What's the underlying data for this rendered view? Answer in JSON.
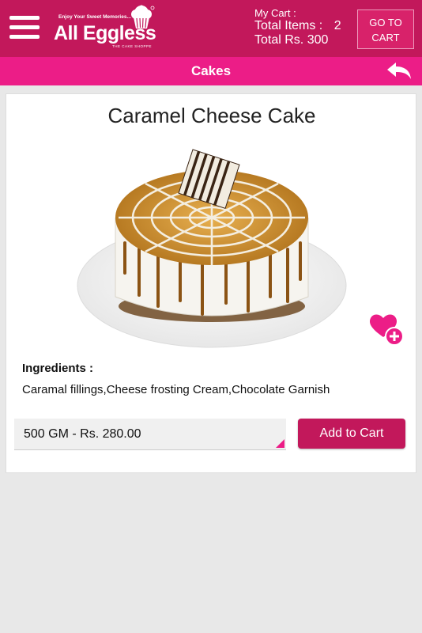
{
  "header": {
    "logo": {
      "tagline": "Enjoy Your Sweet Memories...",
      "name": "All Eggless",
      "subtitle": "THE CAKE SHOPPE"
    },
    "cart": {
      "label": "My Cart  :",
      "total_items_label": "Total Items :",
      "total_items_value": "2",
      "total_amount": "Total Rs. 300"
    },
    "goto_cart": {
      "line1": "GO TO",
      "line2": "CART"
    }
  },
  "titlebar": {
    "title": "Cakes"
  },
  "product": {
    "name": "Caramel Cheese Cake",
    "ingredients_label": "Ingredients :",
    "ingredients": "Caramal fillings,Cheese frosting Cream,Chocolate Garnish",
    "selected_option": "500 GM - Rs. 280.00",
    "add_to_cart": "Add to Cart"
  },
  "colors": {
    "primary": "#c2185b",
    "accent": "#ec1d87",
    "background": "#e8e8e8"
  },
  "icons": [
    "menu-icon",
    "cupcake-logo-icon",
    "back-arrow-icon",
    "heart-plus-icon",
    "dropdown-corner-icon"
  ]
}
